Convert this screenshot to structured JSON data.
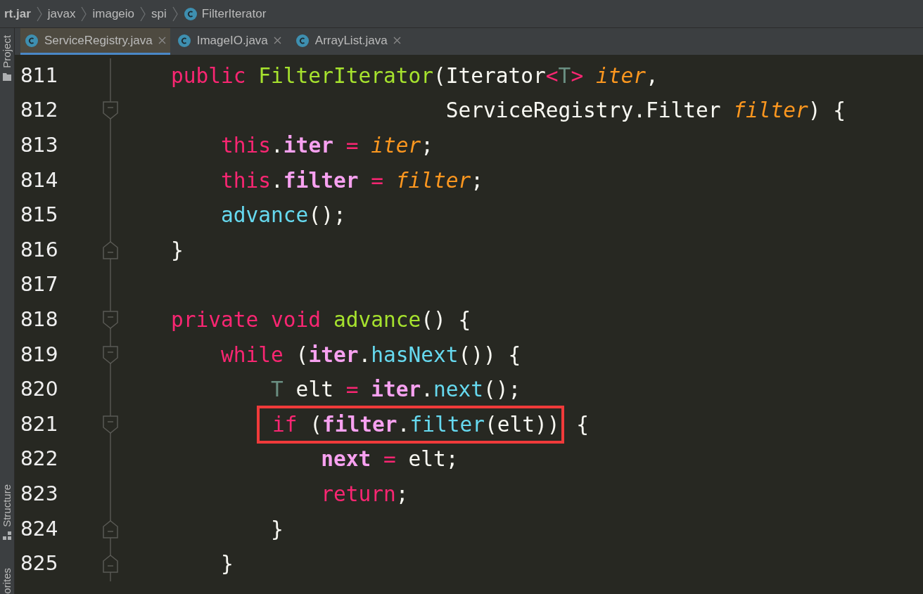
{
  "breadcrumbs": [
    {
      "label": "rt.jar",
      "kind": "root"
    },
    {
      "label": "javax",
      "kind": "package"
    },
    {
      "label": "imageio",
      "kind": "package"
    },
    {
      "label": "spi",
      "kind": "package"
    },
    {
      "label": "FilterIterator",
      "kind": "class"
    }
  ],
  "tabs": [
    {
      "label": "ServiceRegistry.java",
      "selected": true
    },
    {
      "label": "ImageIO.java",
      "selected": false
    },
    {
      "label": "ArrayList.java",
      "selected": false
    }
  ],
  "tool_strip": [
    {
      "label": "Project",
      "kind": "folder"
    },
    {
      "label": "Structure",
      "kind": "structure"
    },
    {
      "label": "orites",
      "kind": "plain"
    }
  ],
  "lines": [
    {
      "number": "811",
      "fold_open": false,
      "fold_close": false,
      "tokens": [
        {
          "kind": "keyword",
          "text": "public "
        },
        {
          "kind": "decl",
          "text": "FilterIterator"
        },
        {
          "kind": "plain",
          "text": "(Iterator"
        },
        {
          "kind": "keyword",
          "text": "<"
        },
        {
          "kind": "type",
          "text": "T"
        },
        {
          "kind": "keyword",
          "text": ">"
        },
        {
          "kind": "param",
          "text": " iter"
        },
        {
          "kind": "plain",
          "text": ","
        }
      ]
    },
    {
      "number": "812",
      "fold_open": true,
      "fold_close": false,
      "tokens": [
        {
          "kind": "plain",
          "text": "                      ServiceRegistry.Filter "
        },
        {
          "kind": "param",
          "text": "filter"
        },
        {
          "kind": "plain",
          "text": ") {"
        }
      ]
    },
    {
      "number": "813",
      "fold_open": false,
      "fold_close": false,
      "tokens": [
        {
          "kind": "keyword",
          "text": "    this"
        },
        {
          "kind": "plain",
          "text": "."
        },
        {
          "kind": "field",
          "text": "iter"
        },
        {
          "kind": "keyword",
          "text": " = "
        },
        {
          "kind": "param",
          "text": "iter"
        },
        {
          "kind": "plain",
          "text": ";"
        }
      ]
    },
    {
      "number": "814",
      "fold_open": false,
      "fold_close": false,
      "tokens": [
        {
          "kind": "keyword",
          "text": "    this"
        },
        {
          "kind": "plain",
          "text": "."
        },
        {
          "kind": "field",
          "text": "filter"
        },
        {
          "kind": "keyword",
          "text": " = "
        },
        {
          "kind": "param",
          "text": "filter"
        },
        {
          "kind": "plain",
          "text": ";"
        }
      ]
    },
    {
      "number": "815",
      "fold_open": false,
      "fold_close": false,
      "tokens": [
        {
          "kind": "call",
          "text": "    advance"
        },
        {
          "kind": "plain",
          "text": "();"
        }
      ]
    },
    {
      "number": "816",
      "fold_open": false,
      "fold_close": true,
      "tokens": [
        {
          "kind": "plain",
          "text": "}"
        }
      ]
    },
    {
      "number": "817",
      "fold_open": false,
      "fold_close": false
    },
    {
      "number": "818",
      "fold_open": true,
      "fold_close": false,
      "tokens": [
        {
          "kind": "keyword",
          "text": "private void "
        },
        {
          "kind": "decl",
          "text": "advance"
        },
        {
          "kind": "plain",
          "text": "() {"
        }
      ]
    },
    {
      "number": "819",
      "fold_open": true,
      "fold_close": false,
      "tokens": [
        {
          "kind": "keyword",
          "text": "    while"
        },
        {
          "kind": "plain",
          "text": " ("
        },
        {
          "kind": "field",
          "text": "iter"
        },
        {
          "kind": "plain",
          "text": "."
        },
        {
          "kind": "call",
          "text": "hasNext"
        },
        {
          "kind": "plain",
          "text": "()) {"
        }
      ]
    },
    {
      "number": "820",
      "fold_open": false,
      "fold_close": false,
      "tokens": [
        {
          "kind": "type",
          "text": "        T"
        },
        {
          "kind": "plain",
          "text": " elt "
        },
        {
          "kind": "keyword",
          "text": "= "
        },
        {
          "kind": "field",
          "text": "iter"
        },
        {
          "kind": "plain",
          "text": "."
        },
        {
          "kind": "call",
          "text": "next"
        },
        {
          "kind": "plain",
          "text": "();"
        }
      ]
    },
    {
      "number": "821",
      "fold_open": true,
      "fold_close": false,
      "tokens": [
        {
          "kind": "box",
          "tokens": [
            {
              "kind": "keyword",
              "text": "if"
            },
            {
              "kind": "plain",
              "text": " ("
            },
            {
              "kind": "field",
              "text": "filter"
            },
            {
              "kind": "plain",
              "text": "."
            },
            {
              "kind": "call",
              "text": "filter"
            },
            {
              "kind": "plain",
              "text": "(elt))"
            }
          ]
        },
        {
          "kind": "plain",
          "text": " {"
        }
      ]
    },
    {
      "number": "822",
      "fold_open": false,
      "fold_close": false,
      "tokens": [
        {
          "kind": "field",
          "text": "            next"
        },
        {
          "kind": "keyword",
          "text": " = "
        },
        {
          "kind": "plain",
          "text": "elt;"
        }
      ]
    },
    {
      "number": "823",
      "fold_open": false,
      "fold_close": false,
      "tokens": [
        {
          "kind": "keyword",
          "text": "            return"
        },
        {
          "kind": "plain",
          "text": ";"
        }
      ]
    },
    {
      "number": "824",
      "fold_open": false,
      "fold_close": true,
      "tokens": [
        {
          "kind": "plain",
          "text": "        }"
        }
      ]
    },
    {
      "number": "825",
      "fold_open": false,
      "fold_close": true,
      "tokens": [
        {
          "kind": "plain",
          "text": "    }"
        }
      ]
    }
  ]
}
